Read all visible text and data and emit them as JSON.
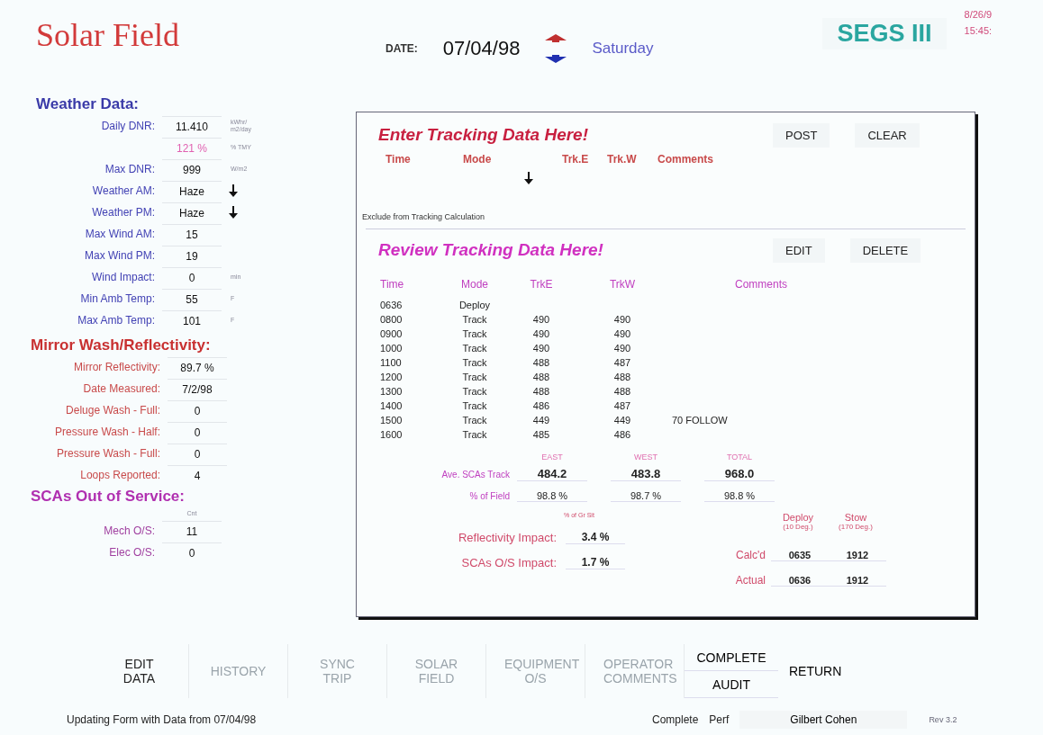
{
  "header": {
    "title": "Solar Field",
    "date_label": "DATE:",
    "date": "07/04/98",
    "weekday": "Saturday",
    "plant": "SEGS III",
    "stamp_date": "8/26/9",
    "stamp_time": "15:45:"
  },
  "weather": {
    "title": "Weather Data:",
    "rows": [
      {
        "kind": "value",
        "label": "Daily DNR:",
        "value": "11.410",
        "unit": "kWhr/ m2/day"
      },
      {
        "kind": "percent",
        "value": "121 %",
        "unit": "% TMY"
      },
      {
        "kind": "value",
        "label": "Max DNR:",
        "value": "999",
        "unit": "W/m2"
      },
      {
        "kind": "select",
        "label": "Weather AM:",
        "value": "Haze"
      },
      {
        "kind": "select",
        "label": "Weather PM:",
        "value": "Haze"
      },
      {
        "kind": "value",
        "label": "Max Wind AM:",
        "value": "15"
      },
      {
        "kind": "value",
        "label": "Max Wind PM:",
        "value": "19"
      },
      {
        "kind": "value",
        "label": "Wind Impact:",
        "value": "0",
        "unit": "min"
      },
      {
        "kind": "value",
        "label": "Min Amb Temp:",
        "value": "55",
        "unit": "F"
      },
      {
        "kind": "value",
        "label": "Max Amb Temp:",
        "value": "101",
        "unit": "F"
      }
    ]
  },
  "mirror": {
    "title": "Mirror Wash/Reflectivity:",
    "rows": [
      {
        "label": "Mirror Reflectivity:",
        "value": "89.7 %"
      },
      {
        "label": "Date Measured:",
        "value": "7/2/98"
      },
      {
        "label": "Deluge Wash - Full:",
        "value": "0"
      },
      {
        "label": "Pressure Wash - Half:",
        "value": "0"
      },
      {
        "label": "Pressure Wash - Full:",
        "value": "0"
      },
      {
        "label": "Loops Reported:",
        "value": "4"
      }
    ]
  },
  "scas": {
    "title": "SCAs Out of Service:",
    "column": "Cnt",
    "rows": [
      {
        "label": "Mech O/S:",
        "value": "11"
      },
      {
        "label": "Elec O/S:",
        "value": "0"
      }
    ]
  },
  "enter": {
    "title": "Enter Tracking Data Here!",
    "buttons": [
      "POST",
      "CLEAR"
    ],
    "columns": [
      "Time",
      "Mode",
      "Trk.E",
      "Trk.W",
      "Comments"
    ],
    "exclude_label": "Exclude from Tracking Calculation"
  },
  "review": {
    "title": "Review Tracking Data Here!",
    "buttons": [
      "EDIT",
      "DELETE"
    ],
    "columns": [
      "Time",
      "Mode",
      "TrkE",
      "TrkW",
      "Comments"
    ],
    "rows": [
      {
        "time": "0636",
        "mode": "Deploy",
        "trk_e": "",
        "trk_w": "",
        "comments": ""
      },
      {
        "time": "0800",
        "mode": "Track",
        "trk_e": "490",
        "trk_w": "490",
        "comments": ""
      },
      {
        "time": "0900",
        "mode": "Track",
        "trk_e": "490",
        "trk_w": "490",
        "comments": ""
      },
      {
        "time": "1000",
        "mode": "Track",
        "trk_e": "490",
        "trk_w": "490",
        "comments": ""
      },
      {
        "time": "1100",
        "mode": "Track",
        "trk_e": "488",
        "trk_w": "487",
        "comments": ""
      },
      {
        "time": "1200",
        "mode": "Track",
        "trk_e": "488",
        "trk_w": "488",
        "comments": ""
      },
      {
        "time": "1300",
        "mode": "Track",
        "trk_e": "488",
        "trk_w": "488",
        "comments": ""
      },
      {
        "time": "1400",
        "mode": "Track",
        "trk_e": "486",
        "trk_w": "487",
        "comments": ""
      },
      {
        "time": "1500",
        "mode": "Track",
        "trk_e": "449",
        "trk_w": "449",
        "comments": "70 FOLLOW"
      },
      {
        "time": "1600",
        "mode": "Track",
        "trk_e": "485",
        "trk_w": "486",
        "comments": ""
      }
    ]
  },
  "summary": {
    "columns": [
      "EAST",
      "WEST",
      "TOTAL"
    ],
    "rows": [
      {
        "label": "Ave. SCAs Track",
        "values": [
          "484.2",
          "483.8",
          "968.0"
        ],
        "bold": true
      },
      {
        "label": "% of Field",
        "values": [
          "98.8 %",
          "98.7 %",
          "98.8 %"
        ],
        "bold": false
      }
    ]
  },
  "impact": {
    "column": "% of Gr Sit",
    "rows": [
      {
        "label": "Reflectivity Impact:",
        "value": "3.4 %"
      },
      {
        "label": "SCAs O/S Impact:",
        "value": "1.7 %"
      }
    ]
  },
  "deploy_stow": {
    "columns": [
      {
        "name": "Deploy",
        "angle": "(10 Deg.)"
      },
      {
        "name": "Stow",
        "angle": "(170 Deg.)"
      }
    ],
    "rows": [
      {
        "label": "Calc'd",
        "values": [
          "0635",
          "1912"
        ]
      },
      {
        "label": "Actual",
        "values": [
          "0636",
          "1912"
        ]
      }
    ]
  },
  "nav": [
    {
      "label": "EDIT DATA",
      "disabled": false
    },
    {
      "label": "HISTORY",
      "disabled": true
    },
    {
      "label": "SYNC TRIP",
      "disabled": true
    },
    {
      "label": "SOLAR FIELD",
      "disabled": true
    },
    {
      "label": "EQUIPMENT O/S",
      "disabled": true
    },
    {
      "label": "OPERATOR COMMENTS",
      "disabled": true
    }
  ],
  "audit": [
    "COMPLETE",
    "AUDIT"
  ],
  "return_button": "RETURN",
  "status": {
    "message": "Updating Form with Data from 07/04/98",
    "complete_label": "Complete",
    "perf_label": "Perf",
    "perf_value": "Gilbert Cohen",
    "revision": "Rev 3.2"
  }
}
